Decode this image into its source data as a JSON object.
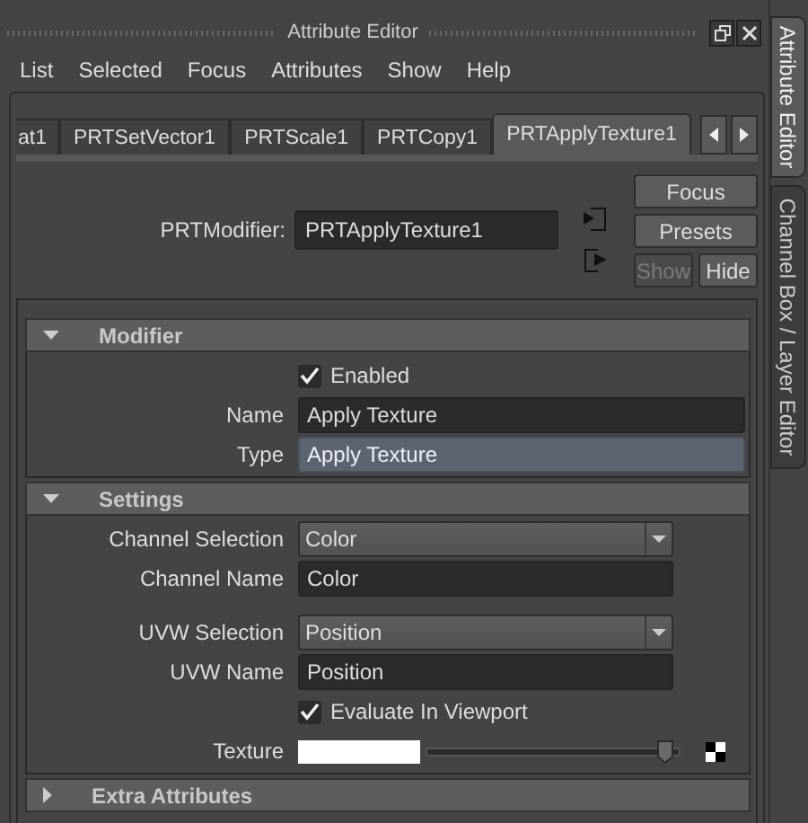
{
  "window": {
    "title": "Attribute Editor"
  },
  "side_tabs": [
    {
      "label": "Attribute Editor",
      "selected": true
    },
    {
      "label": "Channel Box / Layer Editor",
      "selected": false
    }
  ],
  "menu": [
    "List",
    "Selected",
    "Focus",
    "Attributes",
    "Show",
    "Help"
  ],
  "node_tabs": [
    {
      "label": "at1",
      "selected": false
    },
    {
      "label": "PRTSetVector1",
      "selected": false
    },
    {
      "label": "PRTScale1",
      "selected": false
    },
    {
      "label": "PRTCopy1",
      "selected": false
    },
    {
      "label": "PRTApplyTexture1",
      "selected": true
    }
  ],
  "node": {
    "label": "PRTModifier:",
    "value": "PRTApplyTexture1"
  },
  "buttons": [
    {
      "label": "Focus",
      "disabled": false
    },
    {
      "label": "Presets",
      "disabled": false
    },
    {
      "label": "Show",
      "disabled": true
    },
    {
      "label": "Hide",
      "disabled": false
    }
  ],
  "sections": [
    {
      "title": "Modifier",
      "expanded": true,
      "rows": [
        {
          "kind": "checkbox",
          "label": "Enabled",
          "checked": true
        },
        {
          "kind": "field",
          "label": "Name",
          "value": "Apply Texture",
          "locked": false
        },
        {
          "kind": "field",
          "label": "Type",
          "value": "Apply Texture",
          "locked": true
        }
      ]
    },
    {
      "title": "Settings",
      "expanded": true,
      "rows": [
        {
          "kind": "dropdown",
          "label": "Channel Selection",
          "value": "Color"
        },
        {
          "kind": "field",
          "label": "Channel Name",
          "value": "Color",
          "locked": false,
          "short": true
        },
        {
          "kind": "dropdown",
          "label": "UVW Selection",
          "value": "Position"
        },
        {
          "kind": "field",
          "label": "UVW Name",
          "value": "Position",
          "locked": false,
          "short": true
        },
        {
          "kind": "checkbox",
          "label": "Evaluate In Viewport",
          "checked": true
        },
        {
          "kind": "texture",
          "label": "Texture",
          "level": 0.97
        }
      ]
    },
    {
      "title": "Extra Attributes",
      "expanded": false
    }
  ]
}
